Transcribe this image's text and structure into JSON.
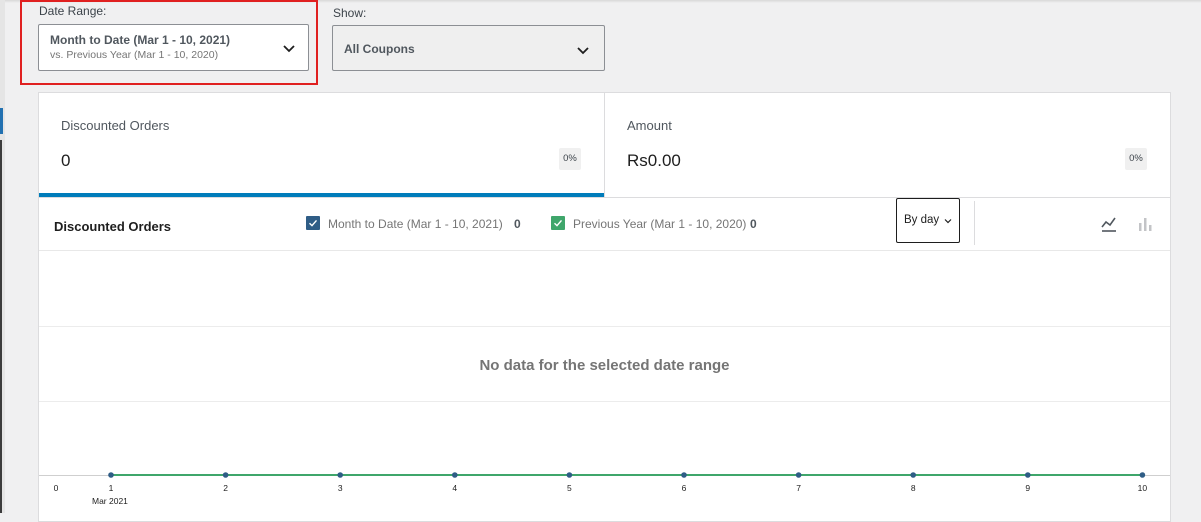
{
  "filters": {
    "date_range_label": "Date Range:",
    "date_range_main": "Month to Date (Mar 1 - 10, 2021)",
    "date_range_sub": "vs. Previous Year (Mar 1 - 10, 2020)",
    "show_label": "Show:",
    "show_value": "All Coupons"
  },
  "tiles": [
    {
      "label": "Discounted Orders",
      "value": "0",
      "change": "0%"
    },
    {
      "label": "Amount",
      "value": "Rs0.00",
      "change": "0%"
    }
  ],
  "chart": {
    "title": "Discounted Orders",
    "legend": [
      {
        "label": "Month to Date (Mar 1 - 10, 2021)",
        "value": "0",
        "color": "#2f5d86",
        "checked": true
      },
      {
        "label": "Previous Year (Mar 1 - 10, 2020)",
        "value": "0",
        "color": "#3fa66b",
        "checked": true
      }
    ],
    "interval": "By day",
    "icons": {
      "line": "line-chart-icon",
      "bar": "bar-chart-icon"
    },
    "empty_message": "No data for the selected date range",
    "y_zero_label": "0",
    "x_month_label": "Mar 2021"
  },
  "chart_data": {
    "type": "line",
    "title": "Discounted Orders",
    "xlabel": "",
    "ylabel": "",
    "x": [
      "1",
      "2",
      "3",
      "4",
      "5",
      "6",
      "7",
      "8",
      "9",
      "10"
    ],
    "series": [
      {
        "name": "Month to Date (Mar 1 - 10, 2021)",
        "values": [
          0,
          0,
          0,
          0,
          0,
          0,
          0,
          0,
          0,
          0
        ]
      },
      {
        "name": "Previous Year (Mar 1 - 10, 2020)",
        "values": [
          0,
          0,
          0,
          0,
          0,
          0,
          0,
          0,
          0,
          0
        ]
      }
    ],
    "grid": true
  }
}
